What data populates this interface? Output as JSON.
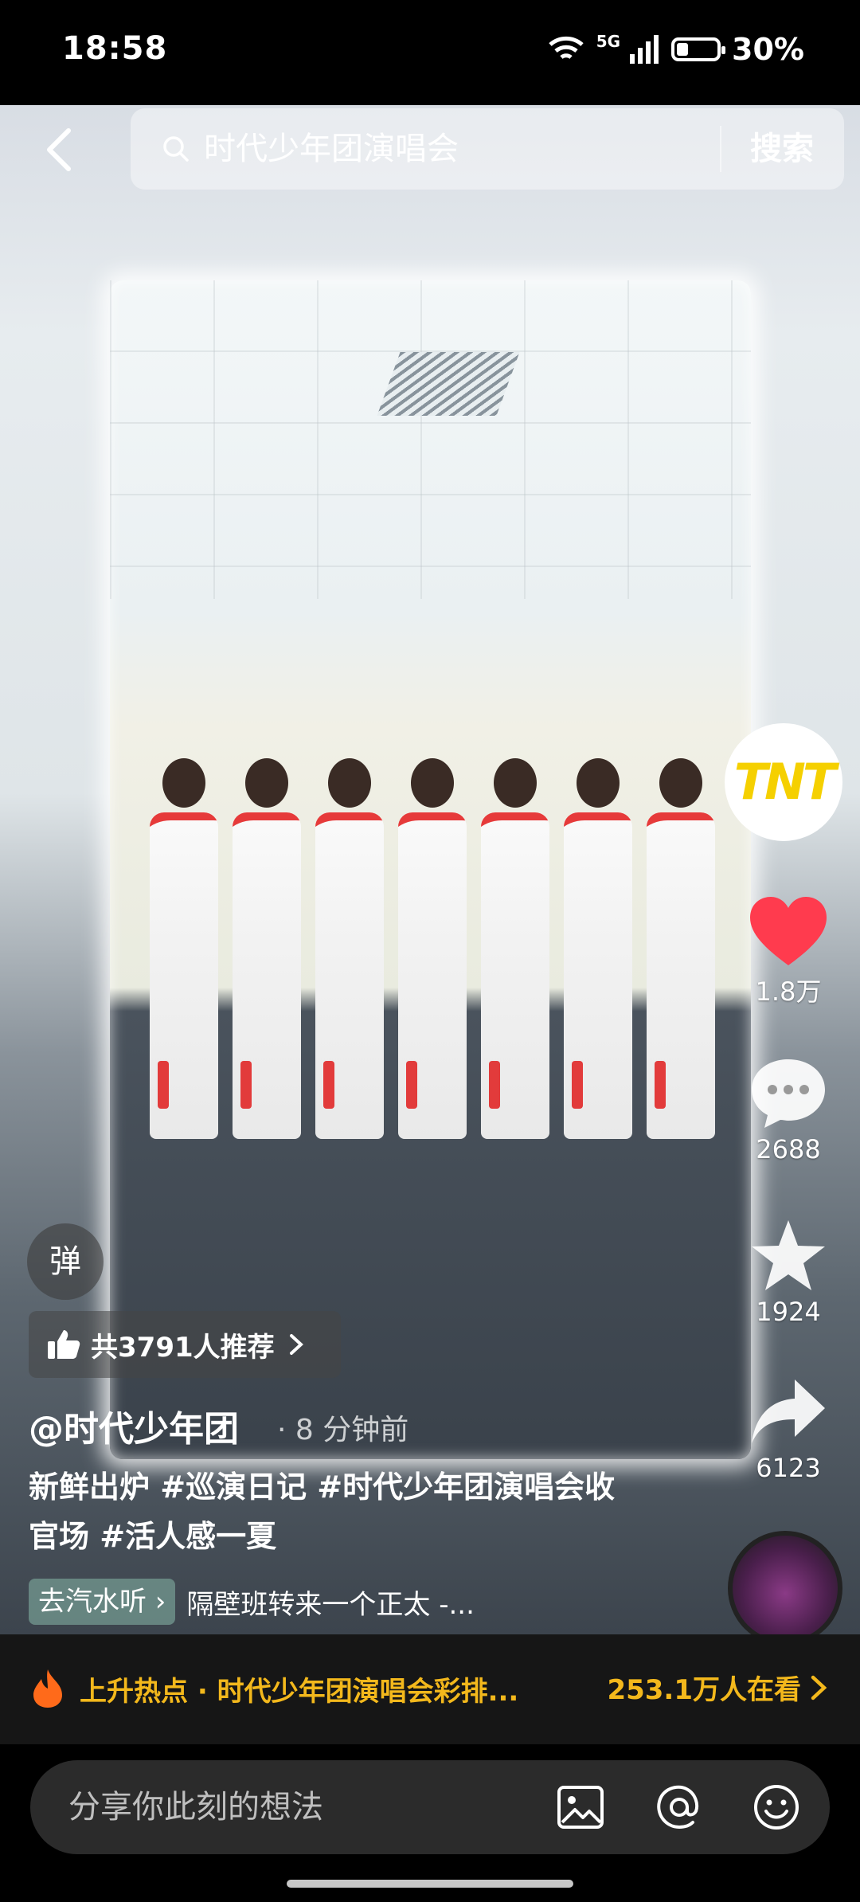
{
  "status_bar": {
    "time": "18:58",
    "network": "5G",
    "battery": "30%"
  },
  "search": {
    "query": "时代少年团演唱会",
    "button": "搜索"
  },
  "rail": {
    "avatar_text": "TNT",
    "likes": "1.8万",
    "comments": "2688",
    "favorites": "1924",
    "shares": "6123"
  },
  "danmu": "弹",
  "recommend": {
    "label": "共3791人推荐"
  },
  "post": {
    "author": "@时代少年团",
    "time": "· 8 分钟前",
    "caption": "新鲜出炉 #巡演日记 #时代少年团演唱会收官场 #活人感一夏"
  },
  "music": {
    "tag": "去汽水听",
    "song": "隔壁班转来一个正太 -..."
  },
  "hot": {
    "label": "上升热点 · 时代少年团演唱会彩排...",
    "viewers": "253.1万人在看"
  },
  "comment": {
    "placeholder": "分享你此刻的想法"
  },
  "colors": {
    "accent_hot": "#f3b81c",
    "like": "#ff3b4e",
    "tnt_yellow": "#f5d000"
  }
}
